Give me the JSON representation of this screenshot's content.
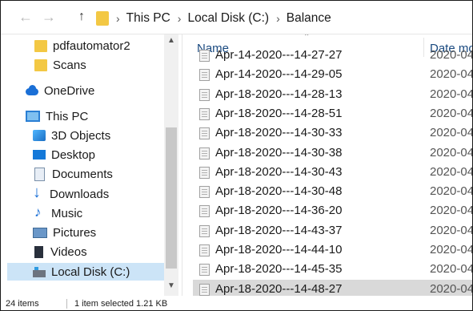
{
  "address_bar": {
    "back_glyph": "←",
    "forward_glyph": "→",
    "up_glyph": "↑",
    "separator": "›",
    "crumbs": [
      "This PC",
      "Local Disk (C:)",
      "Balance"
    ]
  },
  "nav": {
    "items": [
      {
        "label": "pdfautomator2",
        "icon": "folder-icon"
      },
      {
        "label": "Scans",
        "icon": "folder-icon"
      },
      {
        "label": "OneDrive",
        "icon": "onedrive-icon"
      },
      {
        "label": "This PC",
        "icon": "computer-icon"
      },
      {
        "label": "3D Objects",
        "icon": "3d-objects-icon"
      },
      {
        "label": "Desktop",
        "icon": "desktop-icon"
      },
      {
        "label": "Documents",
        "icon": "documents-icon"
      },
      {
        "label": "Downloads",
        "icon": "downloads-icon"
      },
      {
        "label": "Music",
        "icon": "music-icon"
      },
      {
        "label": "Pictures",
        "icon": "pictures-icon"
      },
      {
        "label": "Videos",
        "icon": "videos-icon"
      },
      {
        "label": "Local Disk (C:)",
        "icon": "disk-icon",
        "selected": true
      }
    ]
  },
  "list": {
    "columns": {
      "name": "Name",
      "date": "Date mo"
    },
    "files": [
      {
        "name": "Apr-14-2020---14-27-27",
        "date": "2020-04"
      },
      {
        "name": "Apr-14-2020---14-29-05",
        "date": "2020-04"
      },
      {
        "name": "Apr-18-2020---14-28-13",
        "date": "2020-04"
      },
      {
        "name": "Apr-18-2020---14-28-51",
        "date": "2020-04"
      },
      {
        "name": "Apr-18-2020---14-30-33",
        "date": "2020-04"
      },
      {
        "name": "Apr-18-2020---14-30-38",
        "date": "2020-04"
      },
      {
        "name": "Apr-18-2020---14-30-43",
        "date": "2020-04"
      },
      {
        "name": "Apr-18-2020---14-30-48",
        "date": "2020-04"
      },
      {
        "name": "Apr-18-2020---14-36-20",
        "date": "2020-04"
      },
      {
        "name": "Apr-18-2020---14-43-37",
        "date": "2020-04"
      },
      {
        "name": "Apr-18-2020---14-44-10",
        "date": "2020-04"
      },
      {
        "name": "Apr-18-2020---14-45-35",
        "date": "2020-04"
      },
      {
        "name": "Apr-18-2020---14-48-27",
        "date": "2020-04",
        "selected": true
      }
    ]
  },
  "status": {
    "item_count": "24 items",
    "selection": "1 item selected  1.21 KB"
  }
}
